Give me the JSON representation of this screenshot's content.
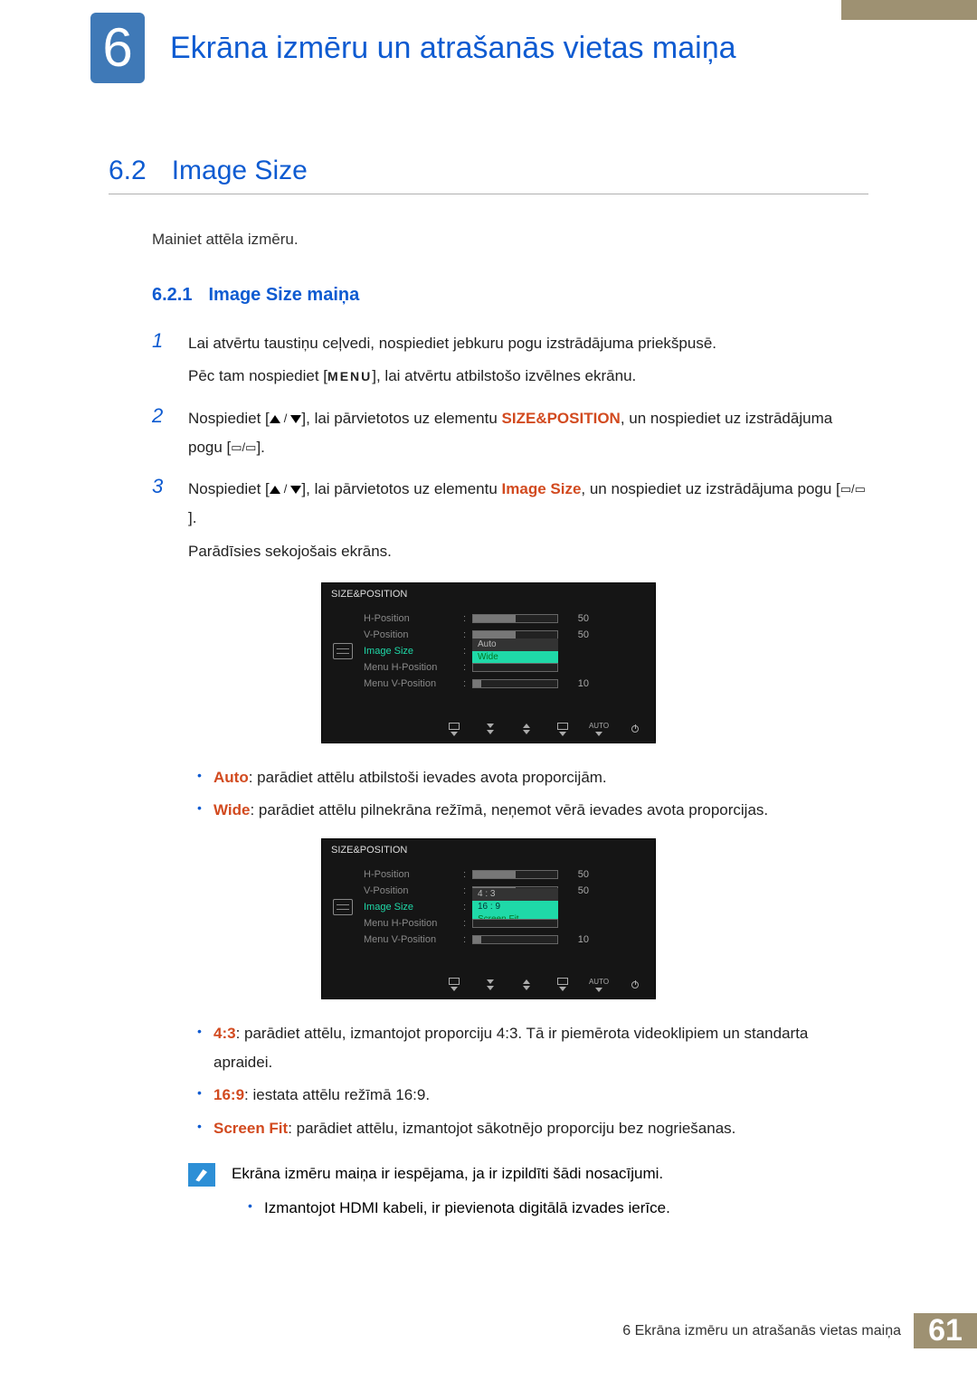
{
  "header": {
    "chapter_number": "6",
    "chapter_title": "Ekrāna izmēru un atrašanās vietas maiņa"
  },
  "section": {
    "number": "6.2",
    "title": "Image Size",
    "intro": "Mainiet attēla izmēru."
  },
  "subsection": {
    "number": "6.2.1",
    "title": "Image Size maiņa"
  },
  "steps": {
    "s1_a": "Lai atvērtu taustiņu ceļvedi, nospiediet jebkuru pogu izstrādājuma priekšpusē.",
    "s1_b_pre": "Pēc tam nospiediet [",
    "s1_b_menu": "MENU",
    "s1_b_post": "], lai atvērtu atbilstošo izvēlnes ekrānu.",
    "s2_pre": "Nospiediet [",
    "s2_mid": "], lai pārvietotos uz elementu ",
    "s2_kw": "SIZE&POSITION",
    "s2_post": ", un nospiediet uz izstrādājuma pogu [",
    "s2_end": "].",
    "s3_pre": "Nospiediet [",
    "s3_mid": "], lai pārvietotos uz elementu ",
    "s3_kw": "Image Size",
    "s3_post": ", un nospiediet uz izstrādājuma pogu [",
    "s3_end": "].",
    "s3_note": "Parādīsies sekojošais ekrāns."
  },
  "osd_common": {
    "title": "SIZE&POSITION",
    "rows": {
      "h_pos": "H-Position",
      "v_pos": "V-Position",
      "img_size": "Image Size",
      "menu_h": "Menu H-Position",
      "menu_v": "Menu V-Position"
    },
    "vals": {
      "fifty": "50",
      "ten": "10"
    },
    "footer_auto": "AUTO"
  },
  "osd1": {
    "dd": {
      "opt1": "Auto",
      "opt2": "Wide"
    }
  },
  "osd2": {
    "dd": {
      "opt1": "4 : 3",
      "opt2": "16 : 9",
      "opt3": "Screen Fit"
    }
  },
  "opts_a": {
    "auto_key": "Auto",
    "auto_txt": ": parādiet attēlu atbilstoši ievades avota proporcijām.",
    "wide_key": "Wide",
    "wide_txt": ": parādiet attēlu pilnekrāna režīmā, neņemot vērā ievades avota proporcijas."
  },
  "opts_b": {
    "r43_key": "4:3",
    "r43_txt": ": parādiet attēlu, izmantojot proporciju 4:3. Tā ir piemērota videoklipiem un standarta apraidei.",
    "r169_key": "16:9",
    "r169_txt": ": iestata attēlu režīmā 16:9.",
    "sf_key": "Screen Fit",
    "sf_txt": ": parādiet attēlu, izmantojot sākotnējo proporciju bez nogriešanas."
  },
  "note": {
    "line1": "Ekrāna izmēru maiņa ir iespējama, ja ir izpildīti šādi nosacījumi.",
    "bullet1": "Izmantojot HDMI kabeli, ir pievienota digitālā izvades ierīce."
  },
  "footer": {
    "text": "6 Ekrāna izmēru un atrašanās vietas maiņa",
    "page": "61"
  }
}
